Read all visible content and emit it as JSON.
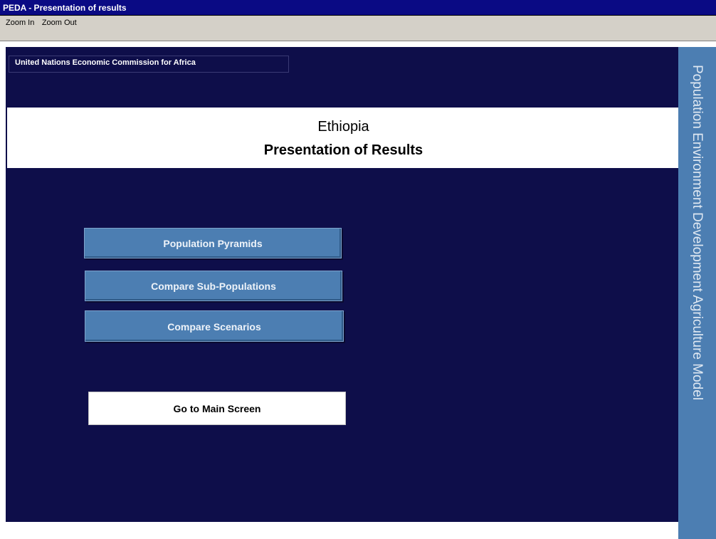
{
  "window": {
    "title": "PEDA - Presentation of results"
  },
  "menu": {
    "items": [
      "Zoom In",
      "Zoom Out"
    ]
  },
  "organization": "United Nations Economic Commission for Africa",
  "header": {
    "country": "Ethiopia",
    "subtitle": "Presentation of Results"
  },
  "side_panel": {
    "text": "Population Environment Development Agriculture Model"
  },
  "buttons": {
    "population_pyramids": "Population Pyramids",
    "compare_sub_populations": "Compare Sub-Populations",
    "compare_scenarios": "Compare Scenarios",
    "main_screen": "Go to Main Screen"
  },
  "colors": {
    "background": "#0e0e4a",
    "title_bar": "#0a0a84",
    "accent": "#4c7eb2",
    "menubar": "#d4d0c8"
  }
}
